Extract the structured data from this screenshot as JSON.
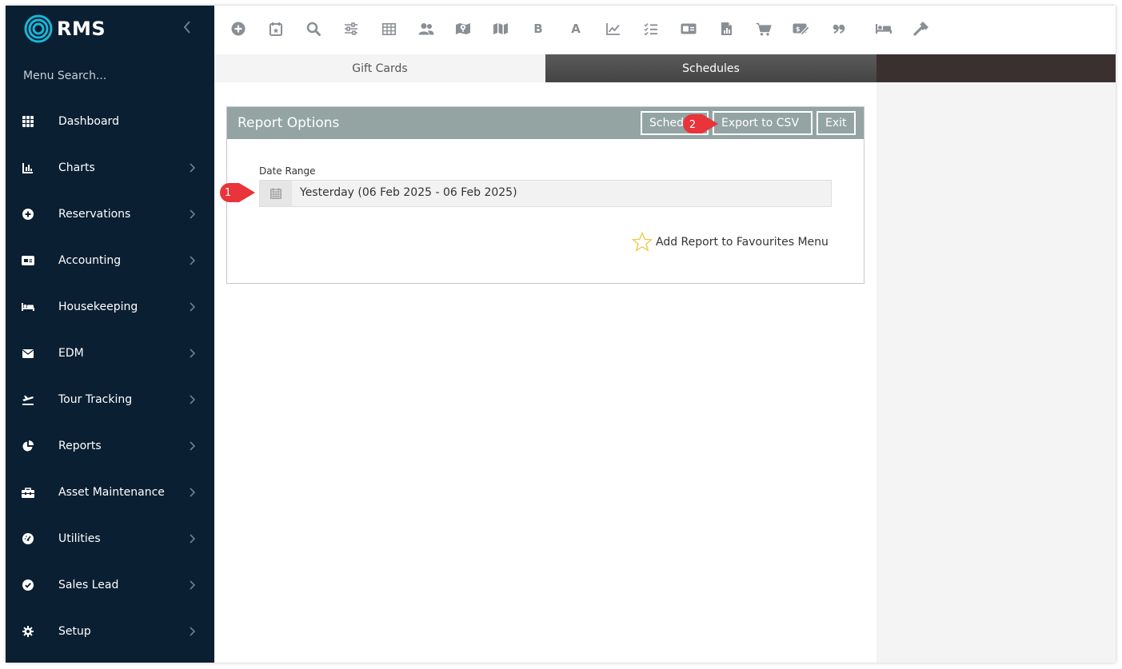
{
  "app": {
    "brand": "RMS"
  },
  "sidebar": {
    "search_placeholder": "Menu Search...",
    "items": [
      {
        "label": "Dashboard",
        "icon": "grid-icon",
        "has_submenu": false
      },
      {
        "label": "Charts",
        "icon": "bar-chart-icon",
        "has_submenu": true
      },
      {
        "label": "Reservations",
        "icon": "plus-circle-icon",
        "has_submenu": true
      },
      {
        "label": "Accounting",
        "icon": "money-card-icon",
        "has_submenu": true
      },
      {
        "label": "Housekeeping",
        "icon": "bed-icon",
        "has_submenu": true
      },
      {
        "label": "EDM",
        "icon": "envelope-icon",
        "has_submenu": true
      },
      {
        "label": "Tour Tracking",
        "icon": "plane-icon",
        "has_submenu": true
      },
      {
        "label": "Reports",
        "icon": "pie-chart-icon",
        "has_submenu": true
      },
      {
        "label": "Asset Maintenance",
        "icon": "toolbox-icon",
        "has_submenu": true
      },
      {
        "label": "Utilities",
        "icon": "gauge-icon",
        "has_submenu": true
      },
      {
        "label": "Sales Lead",
        "icon": "check-circle-icon",
        "has_submenu": true
      },
      {
        "label": "Setup",
        "icon": "gear-icon",
        "has_submenu": true
      }
    ]
  },
  "toolbar": {
    "icons": [
      "plus-circle-icon",
      "calendar-star-icon",
      "search-icon",
      "sliders-icon",
      "table-icon",
      "users-icon",
      "map-marker-icon",
      "map-icon",
      "bold-b-icon",
      "letter-a-icon",
      "line-chart-icon",
      "checklist-icon",
      "money-card-icon",
      "file-chart-icon",
      "cart-icon",
      "money-edit-icon",
      "quote-icon",
      "bed-icon",
      "hammer-icon"
    ],
    "letters": {
      "bold-b-icon": "B",
      "letter-a-icon": "A"
    }
  },
  "tabs": [
    {
      "label": "Gift Cards",
      "active": false
    },
    {
      "label": "Schedules",
      "active": true
    }
  ],
  "report": {
    "title": "Report Options",
    "buttons": {
      "schedule": "Schedule",
      "export": "Export to CSV",
      "exit": "Exit"
    },
    "date_range_label": "Date Range",
    "date_range_value": "Yesterday (06 Feb 2025 - 06 Feb 2025)",
    "favourites_label": "Add Report to Favourites Menu"
  },
  "callouts": {
    "one": "1",
    "two": "2"
  },
  "colors": {
    "sidebar": "#0b1f33",
    "panel_header": "#93a4a3",
    "callout": "#e8343a",
    "brand_ring": "#19b6d6",
    "star": "#f2c94c"
  }
}
